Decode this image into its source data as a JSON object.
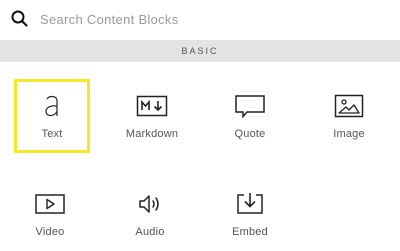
{
  "search": {
    "placeholder": "Search Content Blocks",
    "icon": "search-icon"
  },
  "section": {
    "title": "BASIC"
  },
  "colors": {
    "selected_border": "#f2e92a",
    "header_bg": "#e3e3e3",
    "icon_stroke": "#222222"
  },
  "blocks": [
    {
      "label": "Text",
      "icon": "text-icon",
      "selected": true
    },
    {
      "label": "Markdown",
      "icon": "markdown-icon",
      "selected": false
    },
    {
      "label": "Quote",
      "icon": "quote-icon",
      "selected": false
    },
    {
      "label": "Image",
      "icon": "image-icon",
      "selected": false
    },
    {
      "label": "Video",
      "icon": "video-icon",
      "selected": false
    },
    {
      "label": "Audio",
      "icon": "audio-icon",
      "selected": false
    },
    {
      "label": "Embed",
      "icon": "embed-icon",
      "selected": false
    }
  ]
}
